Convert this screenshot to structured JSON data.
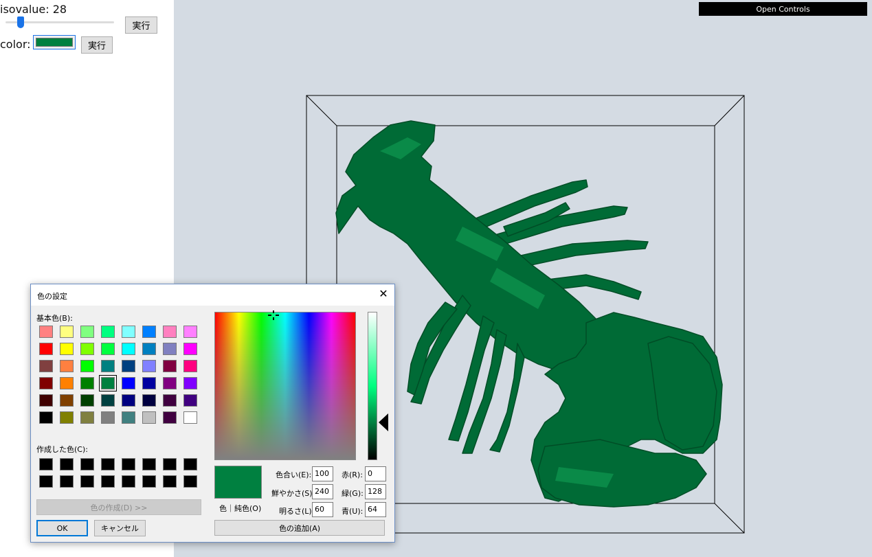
{
  "controls": {
    "isovalue_label": "isovalue: 28",
    "isovalue": 28,
    "apply_label_1": "実行",
    "color_label": "color:",
    "color_value": "#008040",
    "apply_label_2": "実行"
  },
  "viewer": {
    "open_controls": "Open Controls",
    "background": "#d4dbe3",
    "mesh_color": "#006b36"
  },
  "dialog": {
    "title": "色の設定",
    "close": "✕",
    "basic_colors_label": "基本色(B):",
    "basic_colors": [
      [
        "#ff8080",
        "#ffff80",
        "#80ff80",
        "#00ff80",
        "#80ffff",
        "#0080ff",
        "#ff80c0",
        "#ff80ff"
      ],
      [
        "#ff0000",
        "#ffff00",
        "#80ff00",
        "#00ff40",
        "#00ffff",
        "#0080c0",
        "#8080c0",
        "#ff00ff"
      ],
      [
        "#804040",
        "#ff8040",
        "#00ff00",
        "#008080",
        "#004080",
        "#8080ff",
        "#800040",
        "#ff0080"
      ],
      [
        "#800000",
        "#ff8000",
        "#008000",
        "#008040",
        "#0000ff",
        "#0000a0",
        "#800080",
        "#8000ff"
      ],
      [
        "#400000",
        "#804000",
        "#004000",
        "#004040",
        "#000080",
        "#000040",
        "#400040",
        "#400080"
      ],
      [
        "#000000",
        "#808000",
        "#808040",
        "#808080",
        "#408080",
        "#c0c0c0",
        "#400040",
        "#ffffff"
      ]
    ],
    "selected_cell": "#008040",
    "custom_colors_label": "作成した色(C):",
    "custom_colors": [
      "#000000",
      "#000000",
      "#000000",
      "#000000",
      "#000000",
      "#000000",
      "#000000",
      "#000000",
      "#000000",
      "#000000",
      "#000000",
      "#000000",
      "#000000",
      "#000000",
      "#000000",
      "#000000"
    ],
    "define_custom": "色の作成(D) >>",
    "ok": "OK",
    "cancel": "キャンセル",
    "color_solid_label": "色｜純色(O)",
    "hue_label": "色合い(E):",
    "hue": "100",
    "sat_label": "鮮やかさ(S):",
    "sat": "240",
    "lum_label": "明るさ(L):",
    "lum": "60",
    "red_label": "赤(R):",
    "red": "0",
    "green_label": "緑(G):",
    "green": "128",
    "blue_label": "青(U):",
    "blue": "64",
    "add_custom": "色の追加(A)"
  }
}
